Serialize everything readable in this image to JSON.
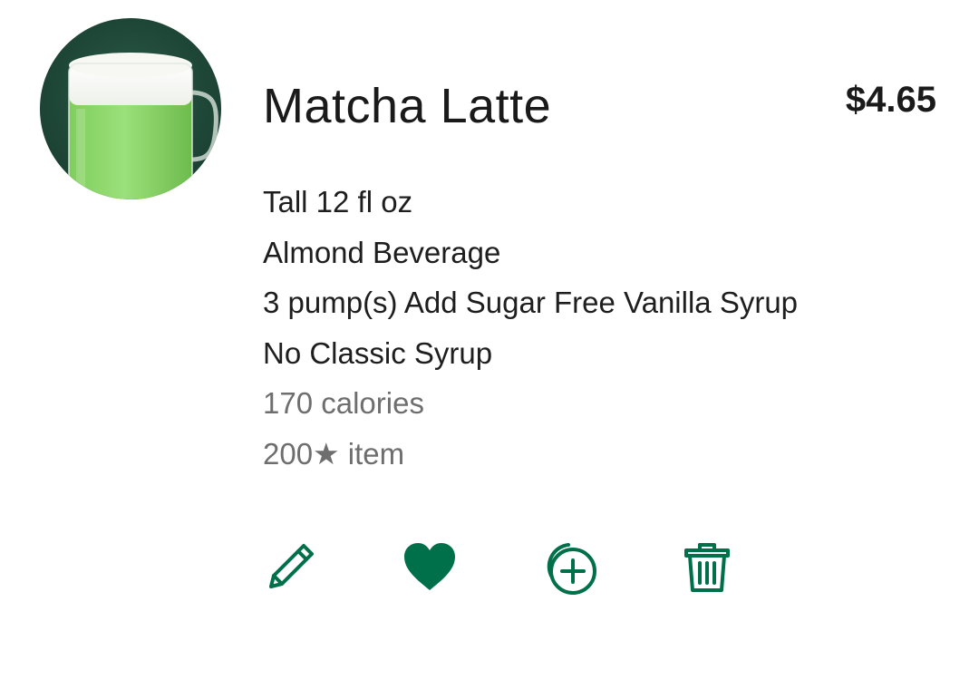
{
  "product": {
    "name": "Matcha Latte",
    "price": "$4.65",
    "image_alt": "matcha-latte-mug",
    "details": [
      "Tall 12 fl oz",
      "Almond Beverage",
      "3 pump(s) Add Sugar Free Vanilla Syrup",
      "No Classic Syrup"
    ],
    "calories": "170 calories",
    "stars": "200★ item"
  },
  "actions": [
    {
      "icon": "pencil-icon",
      "label": "Edit"
    },
    {
      "icon": "heart-icon",
      "label": "Favorite"
    },
    {
      "icon": "duplicate-add-icon",
      "label": "Add another"
    },
    {
      "icon": "trash-icon",
      "label": "Remove"
    }
  ],
  "colors": {
    "accent": "#00704A",
    "text": "#1e1e1e",
    "muted": "#6e6e6e"
  }
}
